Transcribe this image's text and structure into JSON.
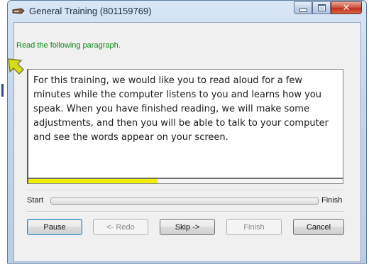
{
  "window": {
    "title": "General Training (801159769)"
  },
  "instruction": "Read the following paragraph.",
  "passage": "For this training, we would like you to read aloud for a few minutes while the computer listens to you and learns how you speak. When you have finished reading, we will make some adjustments, and then you will be able to talk to your computer and see the words appear on your screen.",
  "reading_progress": 0.41,
  "overall_progress": {
    "start_label": "Start",
    "finish_label": "Finish",
    "value": 0.0
  },
  "buttons": {
    "pause": "Pause",
    "redo": "<- Redo",
    "skip": "Skip ->",
    "finish": "Finish",
    "cancel": "Cancel"
  },
  "colors": {
    "instruction_text": "#0a8a14",
    "reading_fill": "#f0f000",
    "close_button": "#c0301b"
  },
  "icons": [
    "speech-app-icon",
    "minimize-icon",
    "maximize-icon",
    "close-icon",
    "reading-pointer-arrow-icon"
  ]
}
